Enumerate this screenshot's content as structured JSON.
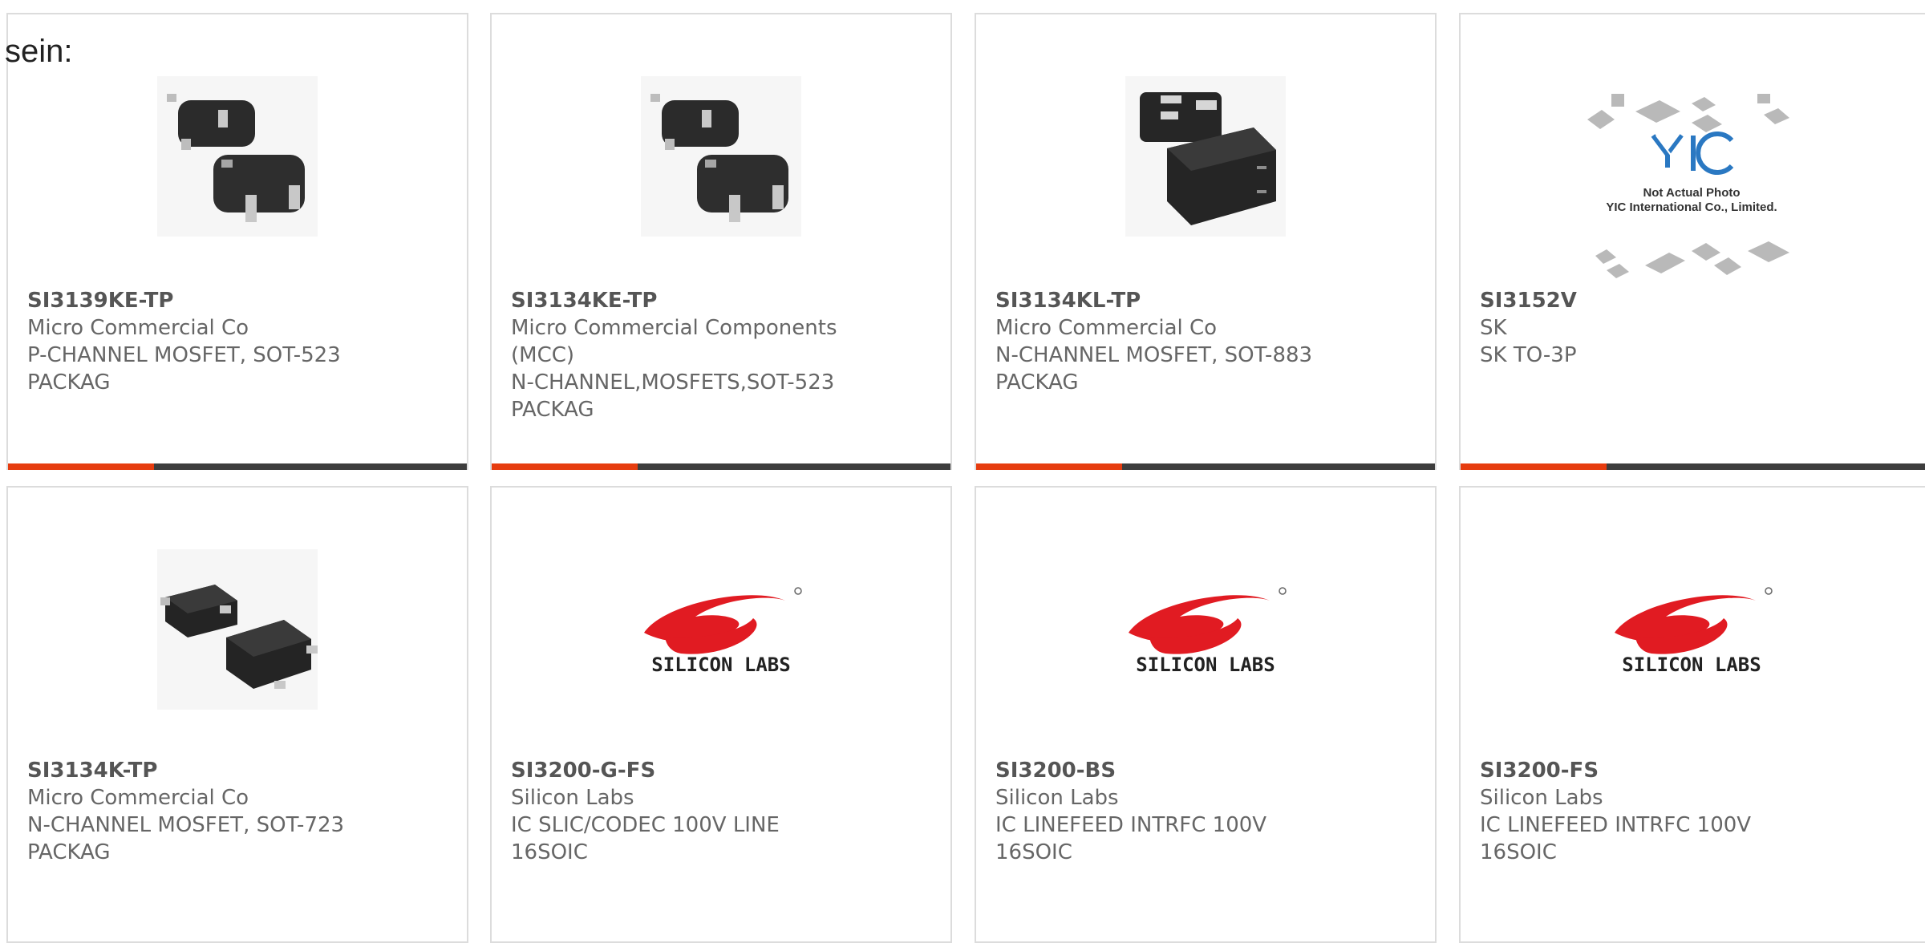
{
  "intro_text": "sein:",
  "colors": {
    "accent": "#e63c0f",
    "bar": "#3d3d3d",
    "border": "#dcdcdc",
    "text": "#666666"
  },
  "products": [
    {
      "part": "SI3139KE-TP",
      "manufacturer": "Micro Commercial Co",
      "desc1": "P-CHANNEL MOSFET, SOT-523",
      "desc2": "PACKAG",
      "image": "sot-523-package-icon"
    },
    {
      "part": "SI3134KE-TP",
      "manufacturer": "Micro Commercial Components",
      "manufacturer2": "(MCC)",
      "desc1": "N-CHANNEL,MOSFETS,SOT-523",
      "desc2": "PACKAG",
      "image": "sot-523-package-icon"
    },
    {
      "part": "SI3134KL-TP",
      "manufacturer": "Micro Commercial Co",
      "desc1": "N-CHANNEL MOSFET, SOT-883",
      "desc2": "PACKAG",
      "image": "sot-883-package-icon"
    },
    {
      "part": "SI3152V",
      "manufacturer": "SK",
      "desc1": "SK TO-3P",
      "desc2": "",
      "image": "yic-placeholder-icon",
      "placeholder_line1": "Not Actual Photo",
      "placeholder_line2": "YIC International Co., Limited."
    },
    {
      "part": "SI3134K-TP",
      "manufacturer": "Micro Commercial Co",
      "desc1": "N-CHANNEL MOSFET, SOT-723",
      "desc2": "PACKAG",
      "image": "sot-723-package-icon"
    },
    {
      "part": "SI3200-G-FS",
      "manufacturer": "Silicon Labs",
      "desc1": "IC SLIC/CODEC 100V LINE",
      "desc2": "16SOIC",
      "image": "silicon-labs-logo",
      "logo_text": "SILICON LABS"
    },
    {
      "part": "SI3200-BS",
      "manufacturer": "Silicon Labs",
      "desc1": "IC LINEFEED INTRFC 100V",
      "desc2": "16SOIC",
      "image": "silicon-labs-logo",
      "logo_text": "SILICON LABS"
    },
    {
      "part": "SI3200-FS",
      "manufacturer": "Silicon Labs",
      "desc1": "IC LINEFEED INTRFC 100V",
      "desc2": "16SOIC",
      "image": "silicon-labs-logo",
      "logo_text": "SILICON LABS"
    }
  ]
}
